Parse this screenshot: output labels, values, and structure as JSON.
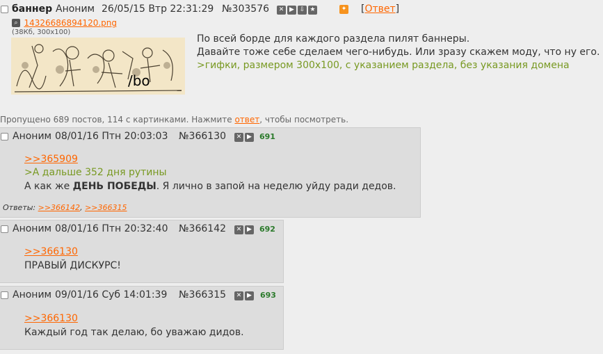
{
  "op": {
    "subject": "баннер",
    "name": "Аноним",
    "date": "26/05/15 Втр 22:31:29",
    "number": "№303576",
    "reply_open": "[",
    "reply_label": "Ответ",
    "reply_close": "]",
    "file_name": "14326686894120.png",
    "file_meta": "(38Кб, 300x100)",
    "image_text": "/bo",
    "lines": [
      "По всей борде для каждого раздела пилят баннеры.",
      "Давайте тоже себе сделаем чего-нибудь. Или зразу скажем моду, что ну его.",
      ">гифки, размером 300x100, с указанием раздела, без указания домена"
    ]
  },
  "omitted": {
    "prefix": "Пропущено 689 постов, 114 с картинками. Нажмите ",
    "link": "ответ",
    "suffix": ", чтобы посмотреть."
  },
  "posts": [
    {
      "name": "Аноним",
      "date": "08/01/16 Птн 20:03:03",
      "number": "№366130",
      "count": "691",
      "reflink": ">>365909",
      "quote": ">А дальше 352 дня рутины",
      "text_before": "А как же ",
      "text_bold": "ДЕНЬ ПОБЕДЫ",
      "text_after": ". Я лично в запой на неделю уйду ради дедов.",
      "replies_label": "Ответы: ",
      "replies": [
        ">>366142",
        ">>366315"
      ]
    },
    {
      "name": "Аноним",
      "date": "08/01/16 Птн 20:32:40",
      "number": "№366142",
      "count": "692",
      "reflink": ">>366130",
      "text": "ПРАВЫЙ ДИСКУРС!"
    },
    {
      "name": "Аноним",
      "date": "09/01/16 Суб 14:01:39",
      "number": "№366315",
      "count": "693",
      "reflink": ">>366130",
      "text": "Каждый год так делаю, бо уважаю дидов."
    }
  ],
  "colors": {
    "link": "#ff6600",
    "quote": "#789922",
    "post_bg": "#dddddd",
    "page_bg": "#eeeeee"
  }
}
